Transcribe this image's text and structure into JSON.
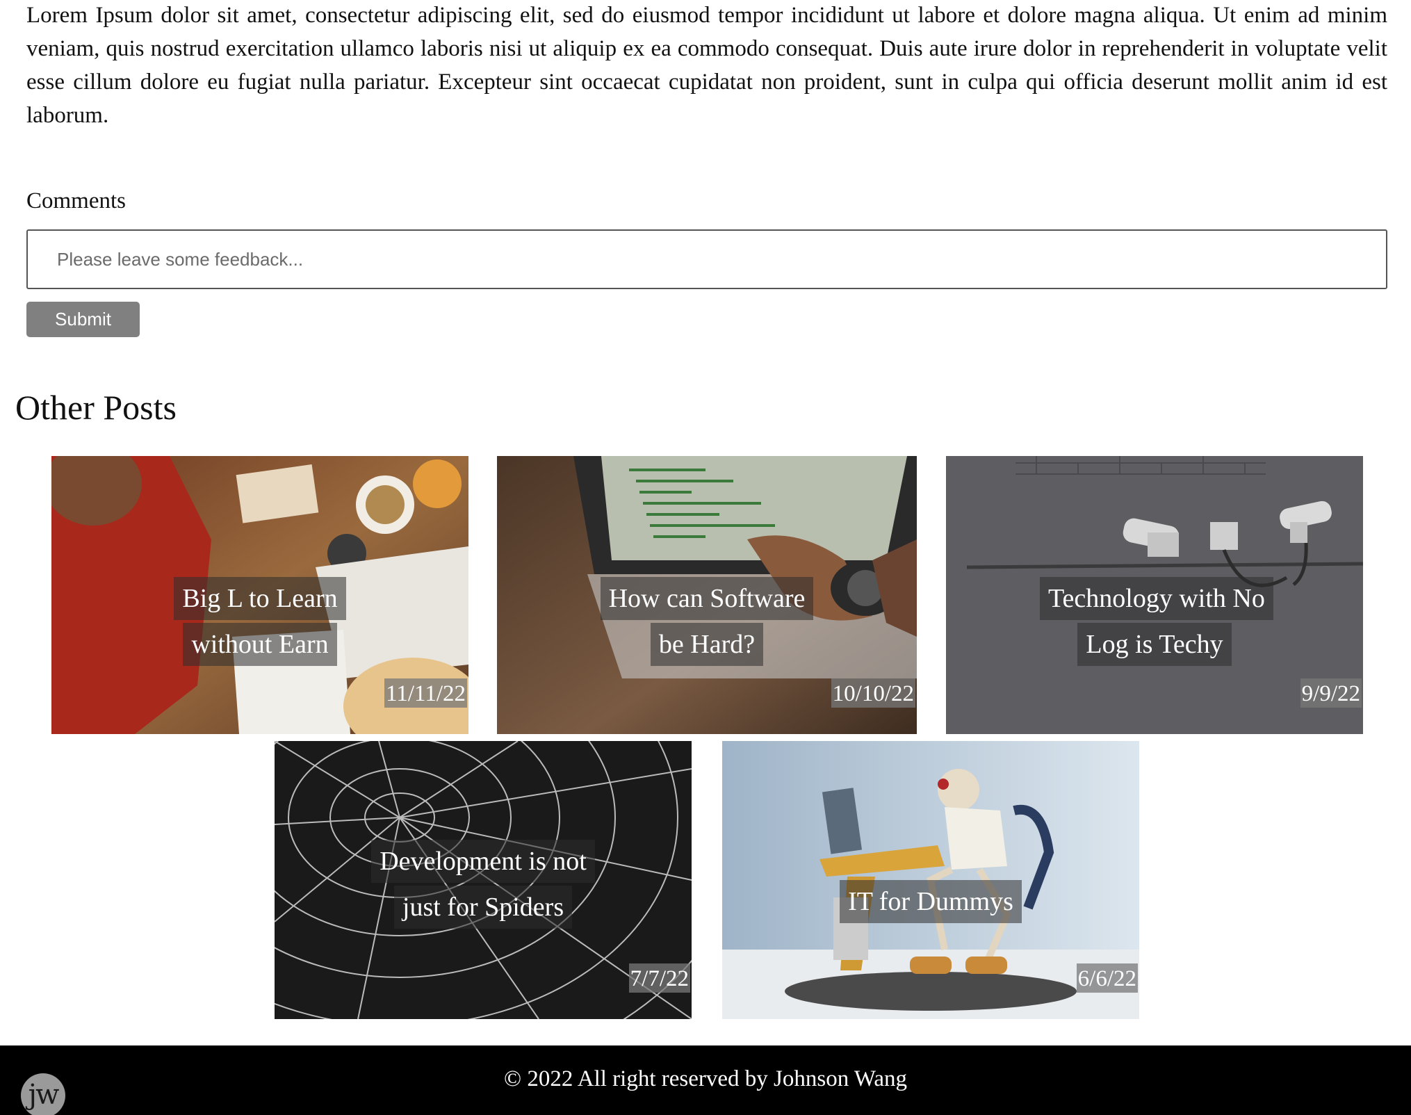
{
  "article": {
    "body": "Lorem Ipsum dolor sit amet, consectetur adipiscing elit, sed do eiusmod tempor incididunt ut labore et dolore magna aliqua. Ut enim ad minim veniam, quis nostrud exercitation ullamco laboris nisi ut aliquip ex ea commodo consequat. Duis aute irure dolor in reprehenderit in voluptate velit esse cillum dolore eu fugiat nulla pariatur. Excepteur sint occaecat cupidatat non proident, sunt in culpa qui officia deserunt mollit anim id est laborum."
  },
  "comments": {
    "label": "Comments",
    "placeholder": "Please leave some feedback...",
    "value": "",
    "submit_label": "Submit"
  },
  "other_posts": {
    "title": "Other Posts",
    "posts": [
      {
        "title": "Big L to Learn without Earn",
        "date": "11/11/22",
        "image": "student-studying-at-desk"
      },
      {
        "title": "How can Software be Hard?",
        "date": "10/10/22",
        "image": "laptop-with-code"
      },
      {
        "title": "Technology with No Log is Techy",
        "date": "9/9/22",
        "image": "security-cameras-on-wall"
      },
      {
        "title": "Development is not just for Spiders",
        "date": "7/7/22",
        "image": "spider-web"
      },
      {
        "title": "IT for Dummys",
        "date": "6/6/22",
        "image": "skeleton-at-computer-figurine"
      }
    ]
  },
  "footer": {
    "copyright": "© 2022 All right reserved by Johnson Wang",
    "logo_text": "jw"
  }
}
